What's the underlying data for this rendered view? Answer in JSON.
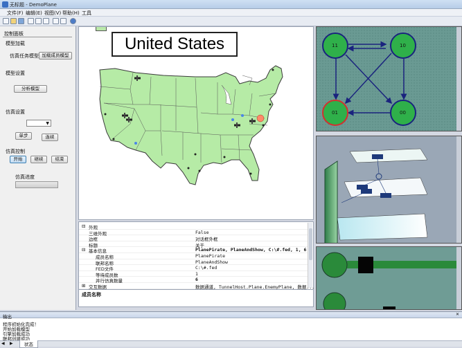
{
  "window": {
    "title": "无标题 - DemoPlane"
  },
  "menu": [
    "文件(F)",
    "编辑(E)",
    "视图(V)",
    "帮助(H)",
    "工具"
  ],
  "left_panel": {
    "header": "控制面板",
    "sections": {
      "model_load": "模型加载",
      "sim_task_model": "仿真任务模型",
      "load_member_btn": "加载成员模型",
      "model_settings": "模型设置",
      "analyze_btn": "分析模型",
      "sim_settings": "仿真设置",
      "step_btn": "单步",
      "continuous_btn": "连续",
      "sim_control": "仿真控制",
      "start_btn": "开始",
      "continue_btn": "继续",
      "end_btn": "结束",
      "progress_label": "仿真进度"
    }
  },
  "map": {
    "title": "United States"
  },
  "properties": {
    "rows": [
      {
        "key": "外观",
        "value": "",
        "group": true
      },
      {
        "key": "三维外观",
        "value": "False",
        "group": false
      },
      {
        "key": "边框",
        "value": "对话框外框",
        "group": false
      },
      {
        "key": "标题",
        "value": "关于",
        "group": false
      },
      {
        "key": "基本信息",
        "value": "PlanePirate, PlaneAndShow, C:\\#.fed, 1, 6",
        "group": true
      },
      {
        "key": "成员名称",
        "value": "PlanePirate",
        "group": false
      },
      {
        "key": "联邦名称",
        "value": "PlaneAndShow",
        "group": false
      },
      {
        "key": "FED文件",
        "value": "C:\\#.fed",
        "group": false
      },
      {
        "key": "等待成员数",
        "value": "1",
        "group": false
      },
      {
        "key": "并行仿真数量",
        "value": "6",
        "group": false
      },
      {
        "key": "交互数据",
        "value": "数据通道, TunnelHost.Plane.EnemyPlane, 数据...",
        "group": true
      }
    ],
    "description_title": "成员名称"
  },
  "state_graph": {
    "nodes": [
      "11",
      "10",
      "01",
      "00"
    ]
  },
  "output": {
    "header": "输出",
    "lines": [
      "程序初始化完成！",
      "开始加载模型",
      "引擎加载成功",
      "联邦创建成功"
    ],
    "tab": "状态"
  }
}
